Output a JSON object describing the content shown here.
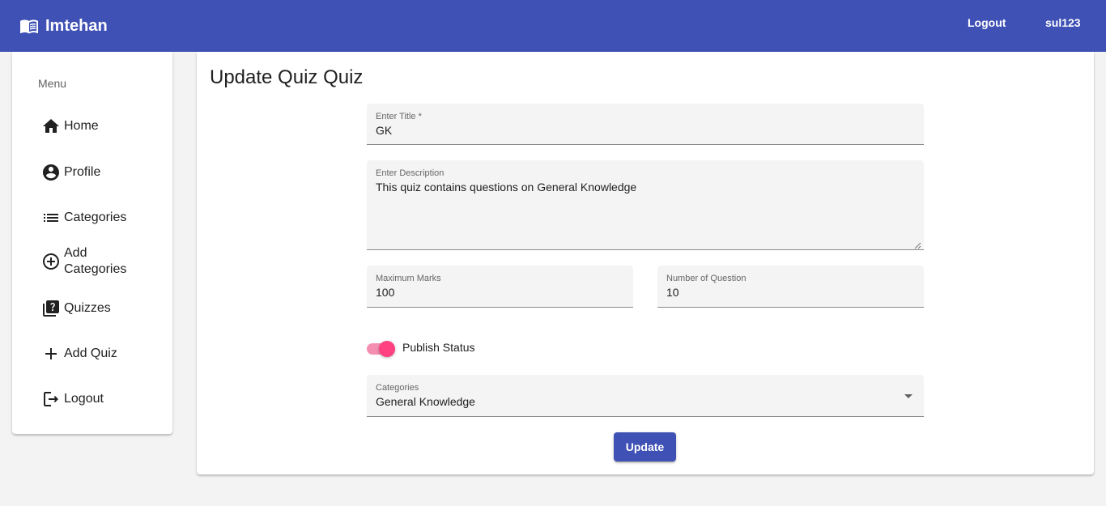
{
  "header": {
    "brand": "Imtehan",
    "logout_label": "Logout",
    "username": "sul123",
    "color": "#3f51b5"
  },
  "sidebar": {
    "title": "Menu",
    "items": [
      {
        "label": "Home",
        "icon": "home-icon"
      },
      {
        "label": "Profile",
        "icon": "account-circle-icon"
      },
      {
        "label": "Categories",
        "icon": "list-icon"
      },
      {
        "label": "Add Categories",
        "icon": "add-circle-outline-icon"
      },
      {
        "label": "Quizzes",
        "icon": "quiz-icon"
      },
      {
        "label": "Add Quiz",
        "icon": "add-icon"
      },
      {
        "label": "Logout",
        "icon": "logout-icon"
      }
    ]
  },
  "main": {
    "title": "Update Quiz Quiz",
    "form": {
      "title_label": "Enter Title *",
      "title_value": "GK",
      "description_label": "Enter Description",
      "description_value": "This quiz contains questions on General Knowledge",
      "max_marks_label": "Maximum Marks",
      "max_marks_value": "100",
      "num_questions_label": "Number of Question",
      "num_questions_value": "10",
      "publish_label": "Publish Status",
      "publish_on": true,
      "category_label": "Categories",
      "category_value": "General Knowledge",
      "submit_label": "Update"
    }
  },
  "colors": {
    "primary": "#3f51b5",
    "accent": "#ff4081"
  }
}
